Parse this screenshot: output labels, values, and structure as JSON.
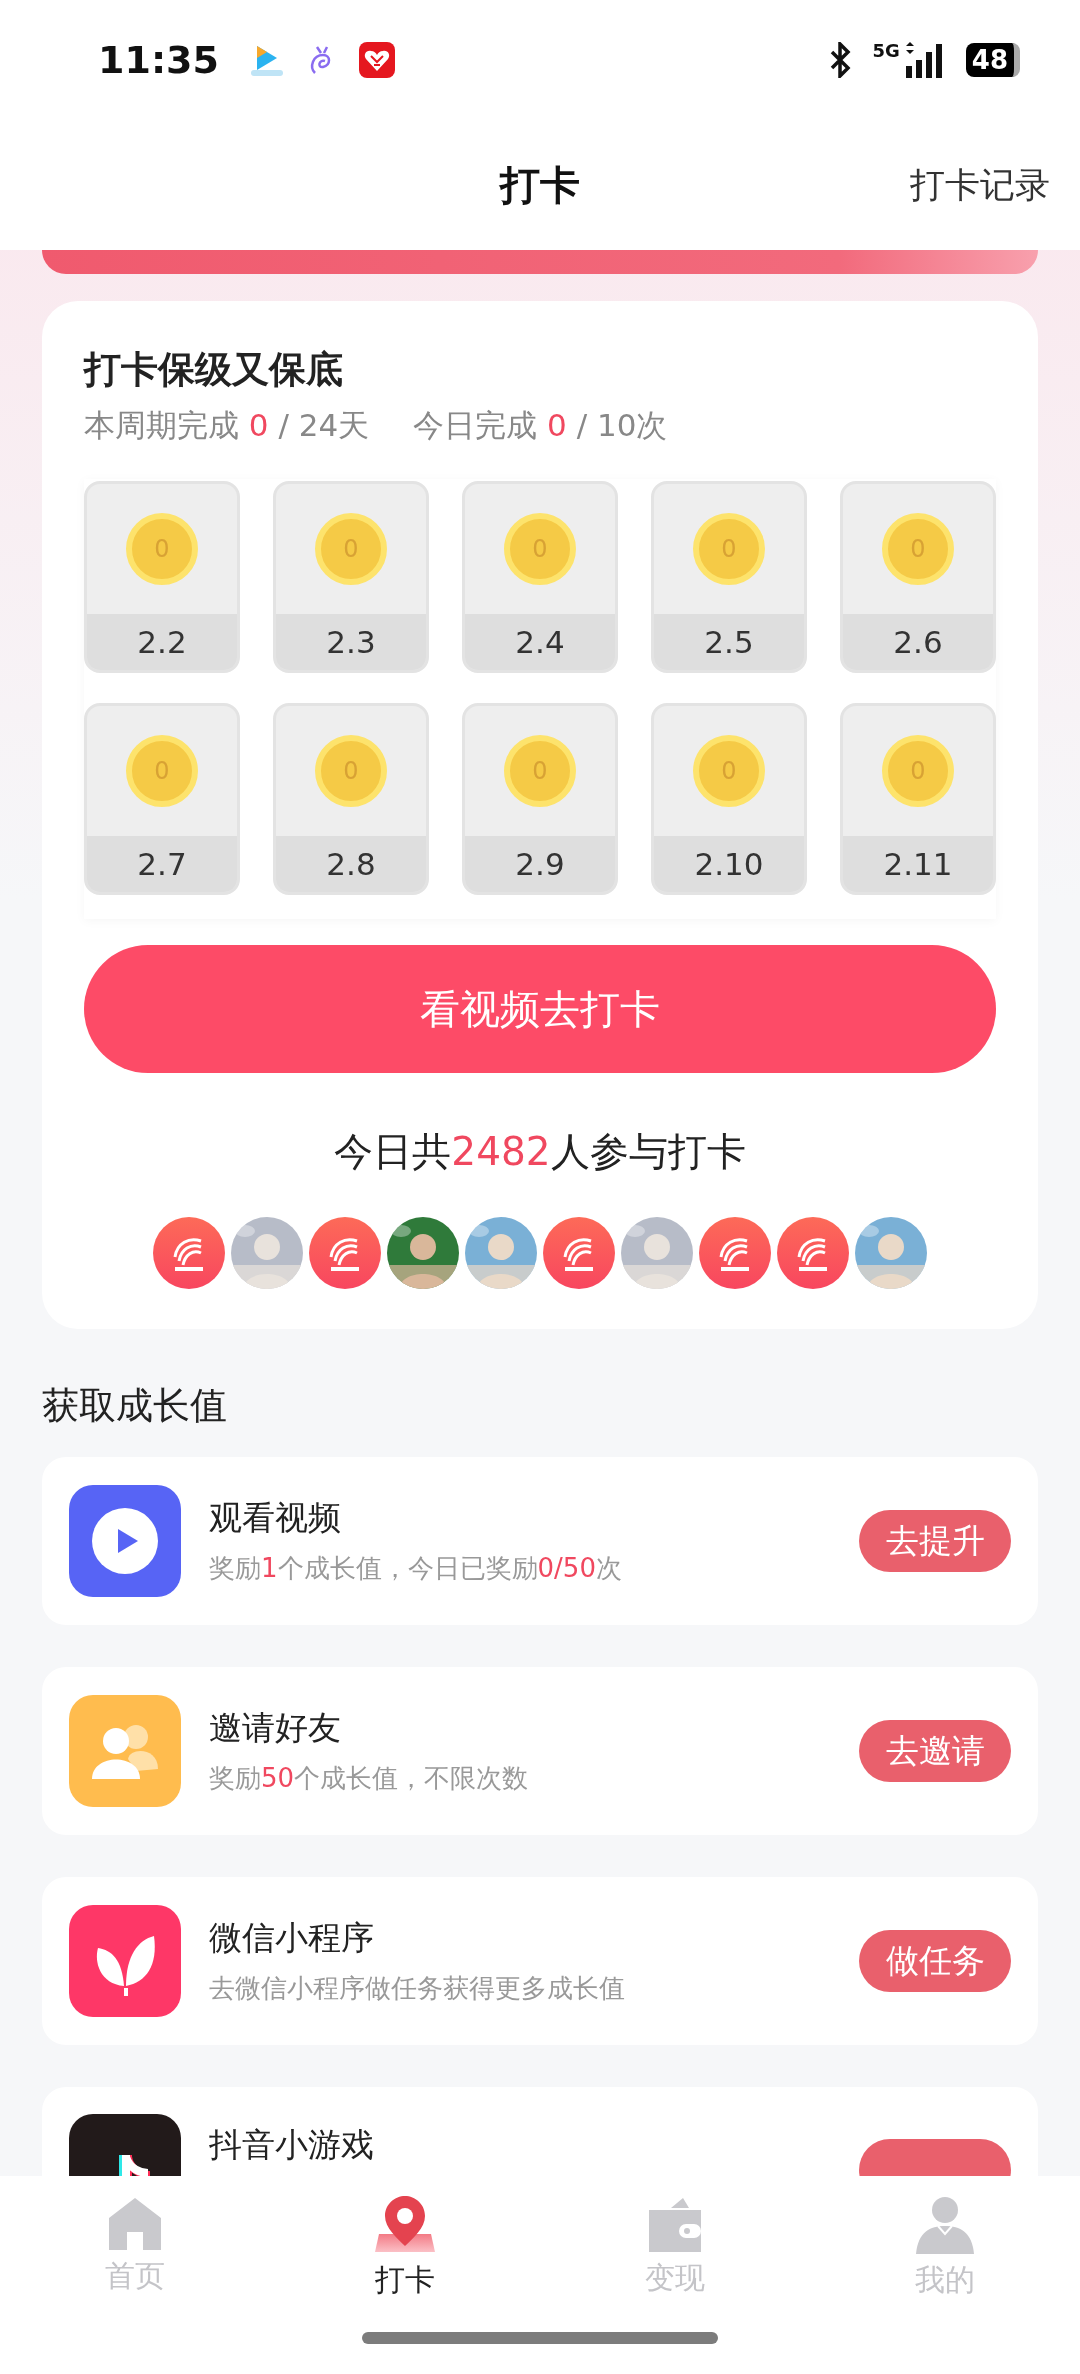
{
  "status_bar": {
    "time": "11:35",
    "network": "5G",
    "battery": "48"
  },
  "header": {
    "title": "打卡",
    "action": "打卡记录"
  },
  "checkin": {
    "title": "打卡保级又保底",
    "stats": [
      {
        "label": "本周期完成",
        "done": "0",
        "total": "/ 24天"
      },
      {
        "label": "今日完成",
        "done": "0",
        "total": "/ 10次"
      }
    ],
    "days": [
      {
        "coin": "0",
        "date": "2.2"
      },
      {
        "coin": "0",
        "date": "2.3"
      },
      {
        "coin": "0",
        "date": "2.4"
      },
      {
        "coin": "0",
        "date": "2.5"
      },
      {
        "coin": "0",
        "date": "2.6"
      },
      {
        "coin": "0",
        "date": "2.7"
      },
      {
        "coin": "0",
        "date": "2.8"
      },
      {
        "coin": "0",
        "date": "2.9"
      },
      {
        "coin": "0",
        "date": "2.10"
      },
      {
        "coin": "0",
        "date": "2.11"
      }
    ],
    "button": "看视频去打卡",
    "participants": {
      "before": "今日共",
      "count": "2482",
      "after": "人参与打卡"
    },
    "avatars": [
      {
        "kind": "logo"
      },
      {
        "kind": "picture"
      },
      {
        "kind": "logo"
      },
      {
        "kind": "picture"
      },
      {
        "kind": "picture"
      },
      {
        "kind": "logo"
      },
      {
        "kind": "picture"
      },
      {
        "kind": "logo"
      },
      {
        "kind": "logo"
      },
      {
        "kind": "picture"
      }
    ]
  },
  "growth": {
    "title": "获取成长值",
    "tasks": [
      {
        "kind": "video",
        "title": "观看视频",
        "subtitle": [
          {
            "text": "奖励",
            "hl": false
          },
          {
            "text": "1",
            "hl": true
          },
          {
            "text": "个成长值，今日已奖励",
            "hl": false
          },
          {
            "text": "0/50",
            "hl": true
          },
          {
            "text": "次",
            "hl": false
          }
        ],
        "button": "去提升"
      },
      {
        "kind": "invite",
        "title": "邀请好友",
        "subtitle": [
          {
            "text": "奖励",
            "hl": false
          },
          {
            "text": "50",
            "hl": true
          },
          {
            "text": "个成长值，不限次数",
            "hl": false
          }
        ],
        "button": "去邀请"
      },
      {
        "kind": "miniapp",
        "title": "微信小程序",
        "subtitle": [
          {
            "text": "去微信小程序做任务获得更多成长值",
            "hl": false
          }
        ],
        "button": "做任务"
      },
      {
        "kind": "game",
        "title": "抖音小游戏"
      }
    ]
  },
  "tab_bar": [
    {
      "kind": "home",
      "label": "首页",
      "selected": false
    },
    {
      "kind": "pin",
      "label": "打卡",
      "selected": true
    },
    {
      "kind": "wallet",
      "label": "变现",
      "selected": false
    },
    {
      "kind": "person",
      "label": "我的",
      "selected": false
    }
  ]
}
